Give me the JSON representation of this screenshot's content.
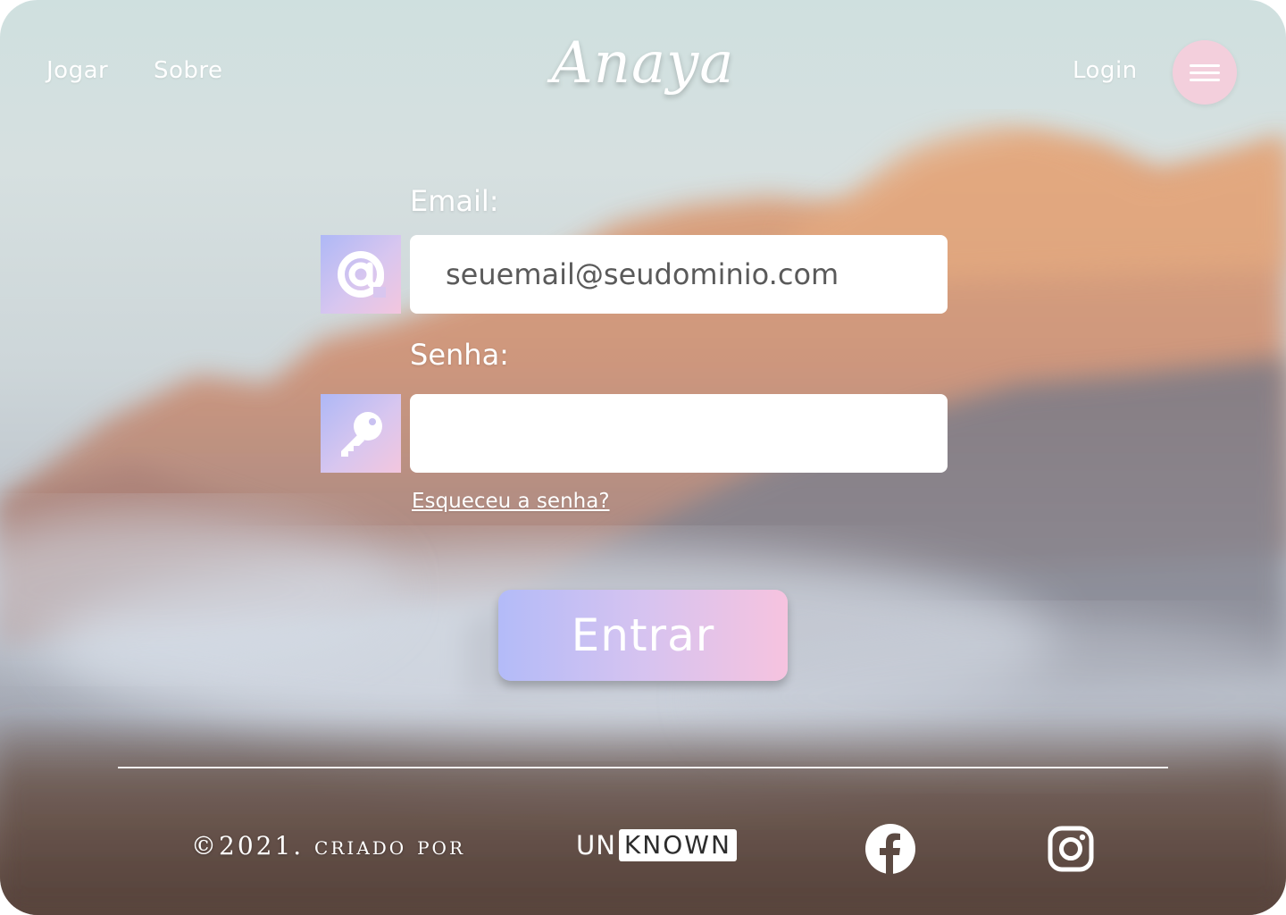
{
  "nav": {
    "jogar": "Jogar",
    "sobre": "Sobre",
    "login": "Login",
    "menu_icon": "hamburger-menu-icon"
  },
  "brand": {
    "logo": "Anaya"
  },
  "form": {
    "email_label": "Email:",
    "email_placeholder": "seuemail@seudominio.com",
    "email_icon": "at-sign-icon",
    "password_label": "Senha:",
    "password_placeholder": "",
    "password_icon": "key-icon",
    "forgot_password": "Esqueceu a senha?",
    "submit_label": "Entrar"
  },
  "footer": {
    "copyright": "©2021. criado por",
    "maker_prefix": "UN",
    "maker_boxed": "KNOWN",
    "social": [
      "facebook-icon",
      "instagram-icon"
    ]
  },
  "colors": {
    "accent_start": "#aeb8f6",
    "accent_end": "#f6c3df",
    "menu_button": "#f3cfdc"
  }
}
